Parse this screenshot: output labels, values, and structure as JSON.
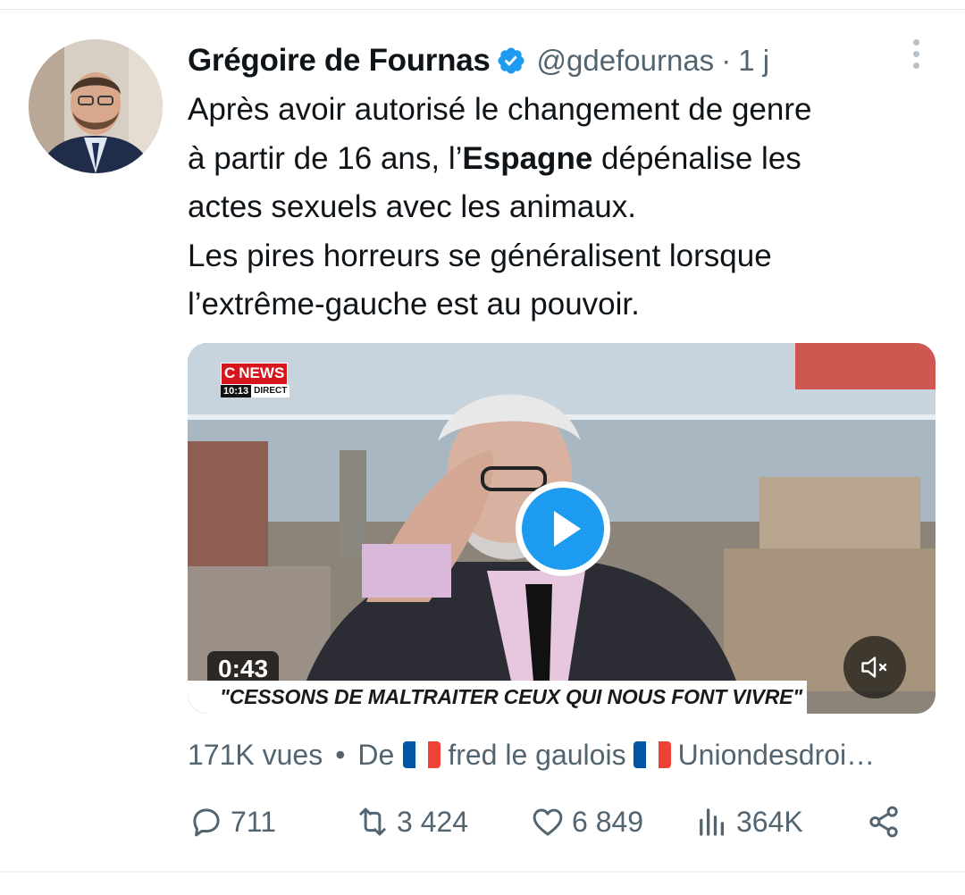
{
  "tweet": {
    "author_name": "Grégoire de Fournas",
    "handle": "@gdefournas",
    "separator": "·",
    "time": "1 j",
    "text_lines": [
      [
        "Après avoir autorisé le changement de genre"
      ],
      [
        "à partir de 16 ans, l’",
        "Espagne",
        " dépénalise les"
      ],
      [
        "actes sexuels avec les animaux."
      ],
      [
        "Les pires horreurs se généralisent lorsque"
      ],
      [
        "l’extrême-gauche est au pouvoir."
      ]
    ]
  },
  "media": {
    "channel_logo_c": "C",
    "channel_logo_news": "NEWS",
    "channel_clock": "10:13",
    "channel_live": "DIRECT",
    "duration": "0:43",
    "caption": "\"CESSONS DE MALTRAITER CEUX QUI NOUS FONT VIVRE\"",
    "play_icon": "play-icon",
    "mute_icon": "muted-speaker-icon"
  },
  "meta": {
    "views": "171K vues",
    "separator": "•",
    "via_label": "De",
    "via_name": "fred le gaulois",
    "via_rest": "Uniondesdroi…",
    "flag_colors": [
      "#0055a4",
      "#ffffff",
      "#ef4135"
    ]
  },
  "actions": {
    "replies": "711",
    "retweets": "3 424",
    "likes": "6 849",
    "views": "364K"
  },
  "colors": {
    "accent": "#1d9bf0",
    "secondary_text": "#536471",
    "primary_text": "#0f1419"
  }
}
